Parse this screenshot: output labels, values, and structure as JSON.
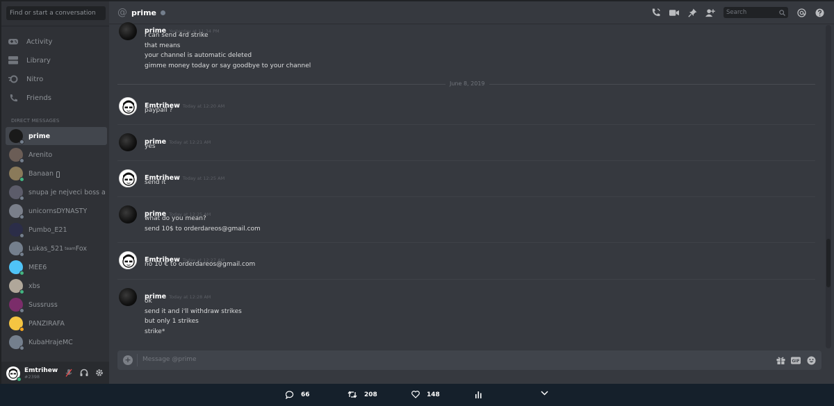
{
  "sidebar": {
    "search_placeholder": "Find or start a conversation",
    "nav": [
      "Activity",
      "Library",
      "Nitro",
      "Friends"
    ],
    "dm_header": "DIRECT MESSAGES",
    "dms": [
      {
        "name": "prime",
        "active": true,
        "status": "offline",
        "avatar_color": "#1a1a1a"
      },
      {
        "name": "Arenito",
        "status": "offline",
        "avatar_color": "#6b5d56"
      },
      {
        "name": "Banaan",
        "status": "online",
        "avatar_color": "#8a7a5a",
        "mobile": true
      },
      {
        "name": "snupa je nejveci boss a ...",
        "status": "offline",
        "avatar_color": "#5c5c6a"
      },
      {
        "name": "unicornsDYNASTY",
        "status": "offline",
        "avatar_color": "#7a7f8a"
      },
      {
        "name": "Pumbo_E21",
        "status": "offline",
        "avatar_color": "#2b2d48"
      },
      {
        "name": "Lukas_521",
        "sup": "team",
        "suffix": "Fox",
        "status": "offline",
        "avatar_color": "#747f8d"
      },
      {
        "name": "MEE6",
        "status": "online",
        "avatar_color": "#4fc3f7"
      },
      {
        "name": "xbs",
        "status": "online",
        "avatar_color": "#b0a79a"
      },
      {
        "name": "Sussruss",
        "status": "offline",
        "avatar_color": "#7b2d6a"
      },
      {
        "name": "PANZIRAFA",
        "status": "idle",
        "avatar_color": "#f5c542"
      },
      {
        "name": "KubaHrajeMC",
        "status": "offline",
        "avatar_color": "#747f8d"
      }
    ],
    "user": {
      "name": "Emtrihew",
      "tag": "#2398"
    }
  },
  "topbar": {
    "channel": "prime",
    "search_placeholder": "Search"
  },
  "messages": [
    {
      "author": "prime",
      "time": "Yesterday at 11:34 PM",
      "avatar": "prime",
      "lines": [
        "i can send 4rd strike",
        "that means",
        "your channel is automatic deleted",
        "gimme money today or say goodbye to your channel"
      ]
    },
    {
      "author": "Emtrihew",
      "time": "Today at 12:20 AM",
      "avatar": "emt",
      "lines": [
        "paypall ?"
      ]
    },
    {
      "author": "prime",
      "time": "Today at 12:21 AM",
      "avatar": "prime",
      "lines": [
        "yes"
      ]
    },
    {
      "author": "Emtrihew",
      "time": "Today at 12:25 AM",
      "avatar": "emt",
      "lines": [
        "send it"
      ]
    },
    {
      "author": "prime",
      "time": "Today at 12:25 AM",
      "avatar": "prime",
      "lines": [
        "what do you mean?",
        "send 10$ to orderdareos@gmail.com"
      ]
    },
    {
      "author": "Emtrihew",
      "time": "Today at 12:27 AM",
      "avatar": "emt",
      "lines": [
        "no 10 € to orderdareos@gmail.com"
      ]
    },
    {
      "author": "prime",
      "time": "Today at 12:28 AM",
      "avatar": "prime",
      "lines": [
        "ok",
        "send it and i'll withdraw strikes",
        "but only 1 strikes",
        "strike*"
      ]
    }
  ],
  "date_divider": "June 8, 2019",
  "composer": {
    "placeholder": "Message @prime"
  },
  "tweet": {
    "replies": "66",
    "retweets": "208",
    "likes": "148"
  },
  "colors": {
    "accent": "#7289da",
    "online": "#43b581",
    "idle": "#faa61a",
    "offline": "#747f8d"
  }
}
